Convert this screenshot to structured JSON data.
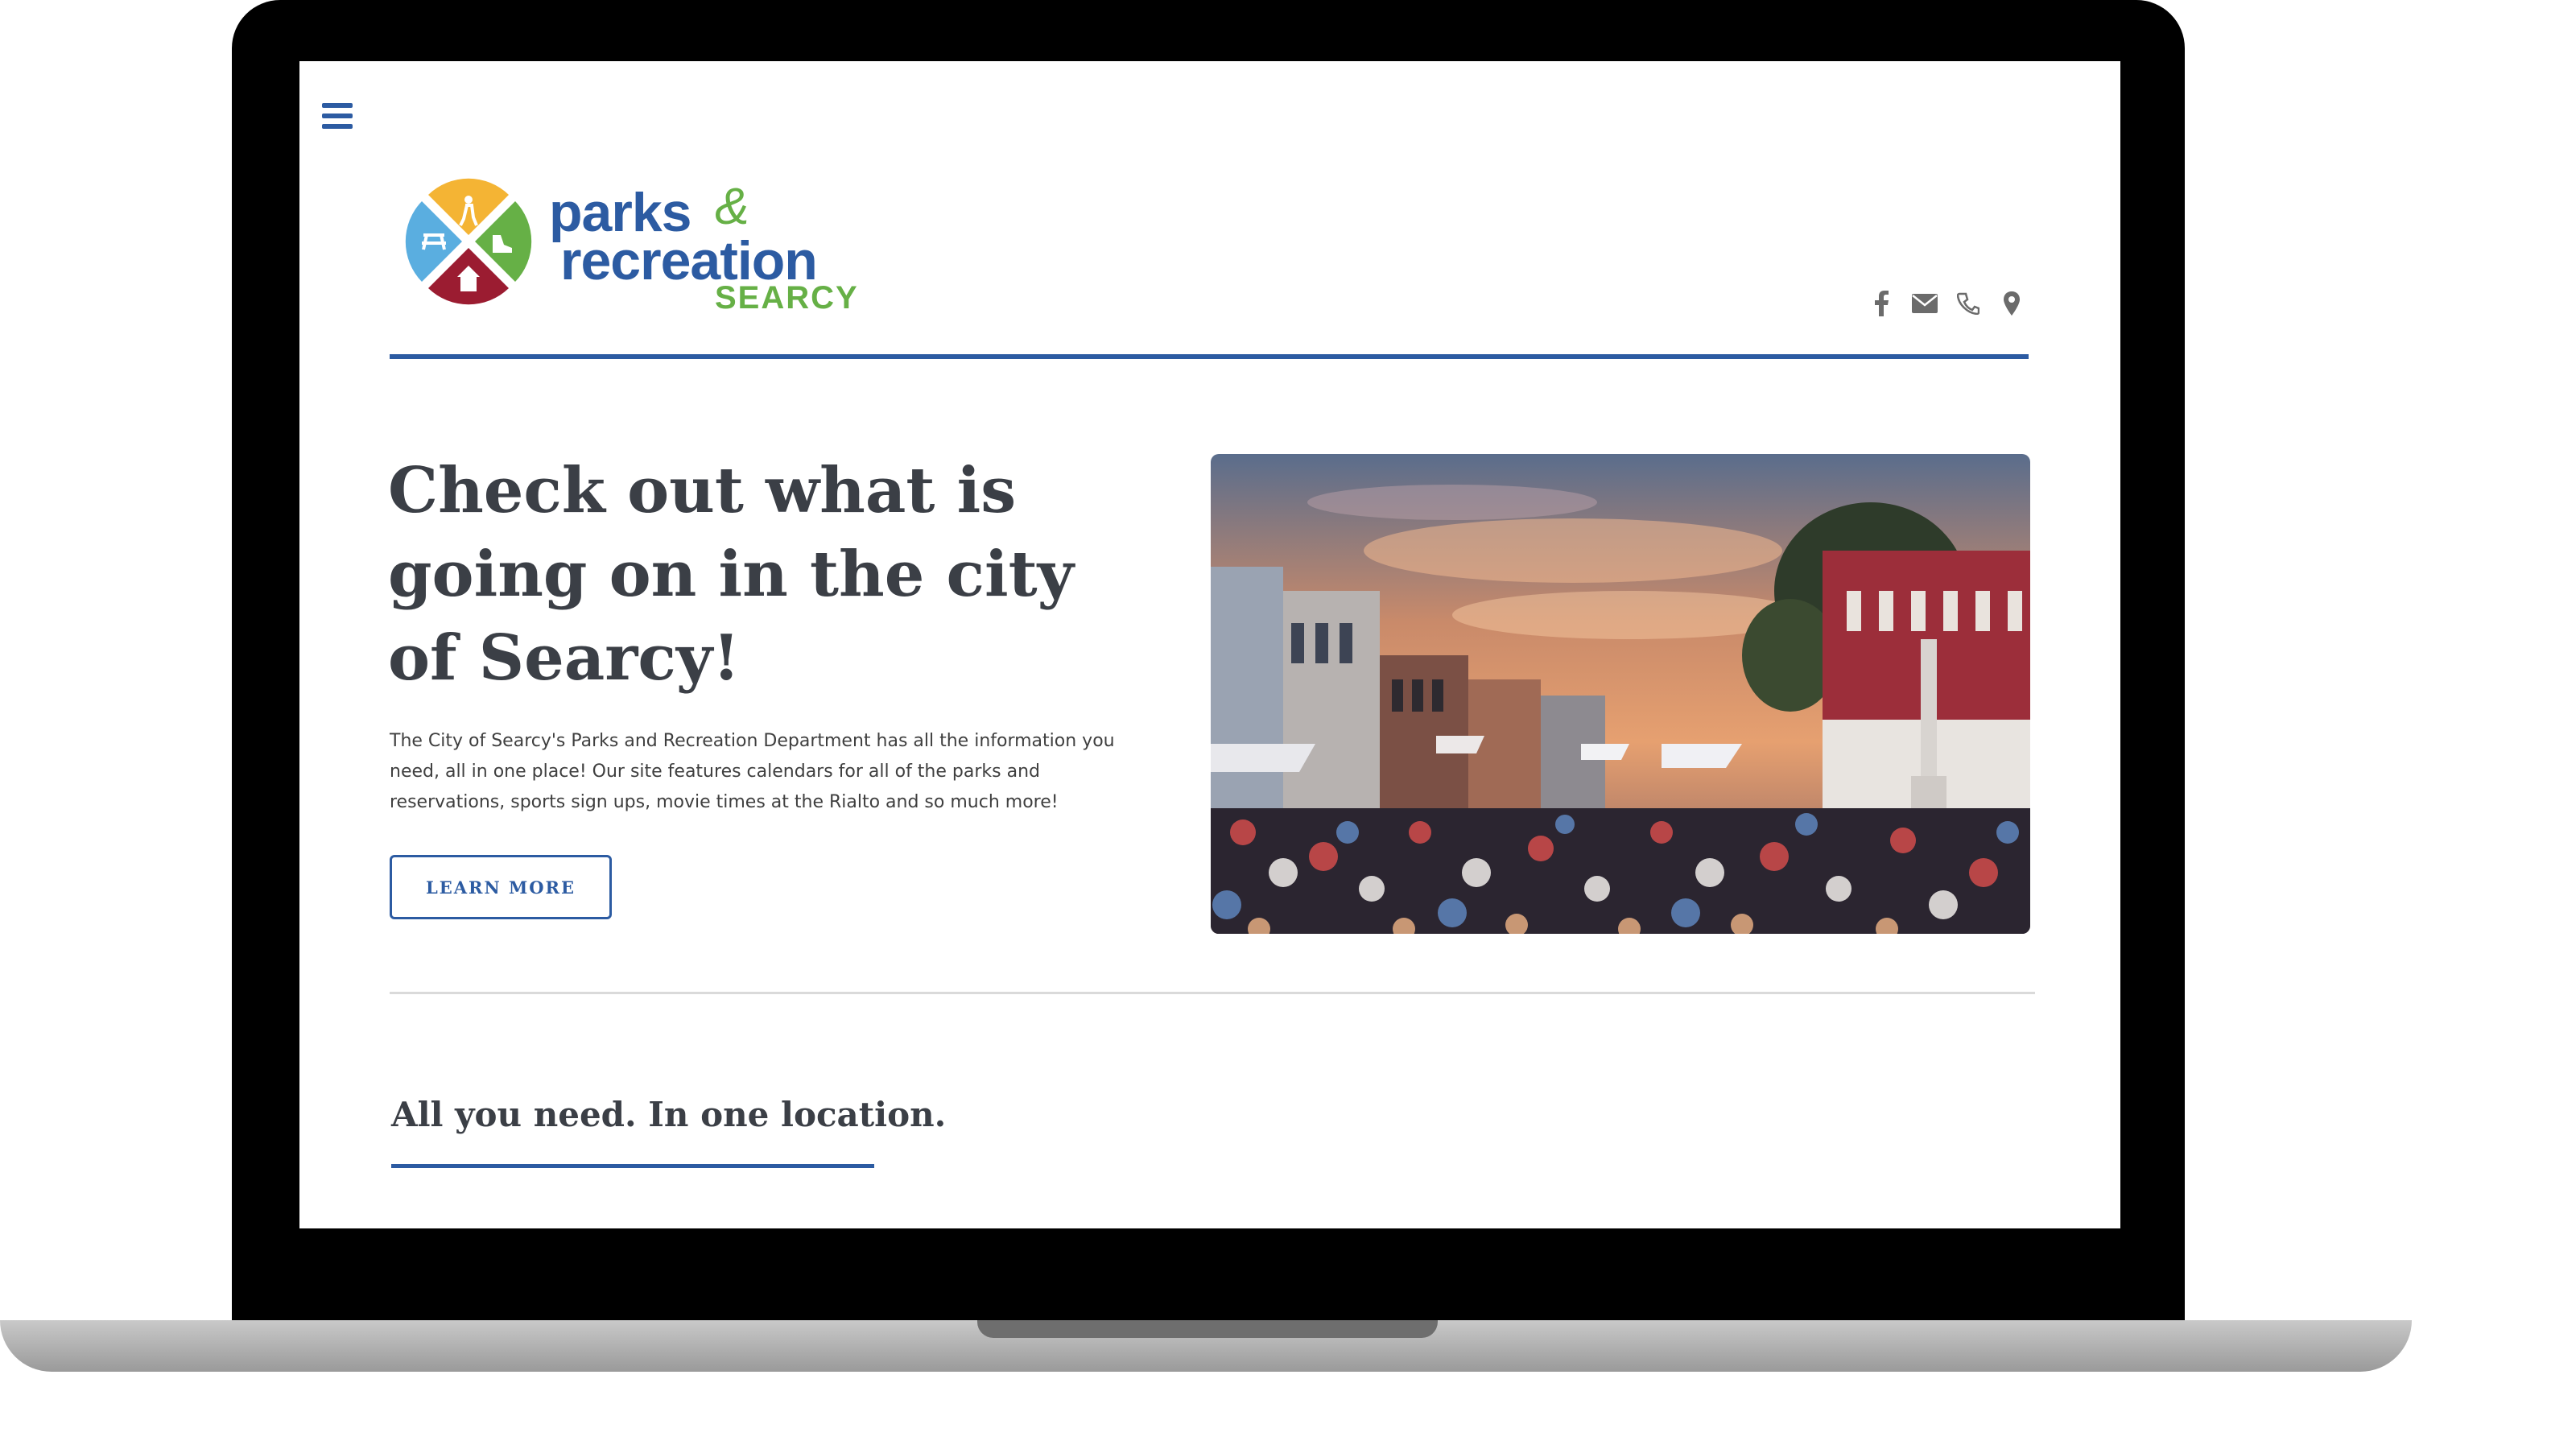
{
  "site": {
    "logo": {
      "parks": "parks",
      "ampersand": "&",
      "recreation": "recreation",
      "city": "SEARCY"
    },
    "social_icons": [
      "facebook-icon",
      "envelope-icon",
      "phone-icon",
      "map-pin-icon"
    ]
  },
  "hero": {
    "title": "Check out what is going on in the city of Searcy!",
    "description": "The City of Searcy's Parks and Recreation Department has all the information you need, all in one place! Our site features calendars for all of the parks and reservations, sports sign ups, movie times at the Rialto and so much more!",
    "button_label": "LEARN MORE"
  },
  "section": {
    "heading": "All you need. In one location."
  },
  "colors": {
    "brand_blue": "#2c5ba2",
    "brand_green": "#66b046",
    "logo_yellow": "#f4b434",
    "logo_lightblue": "#5aaee0",
    "logo_red": "#9b1c31",
    "heading_text": "#3b3f46",
    "social_gray": "#6b6b6b"
  }
}
